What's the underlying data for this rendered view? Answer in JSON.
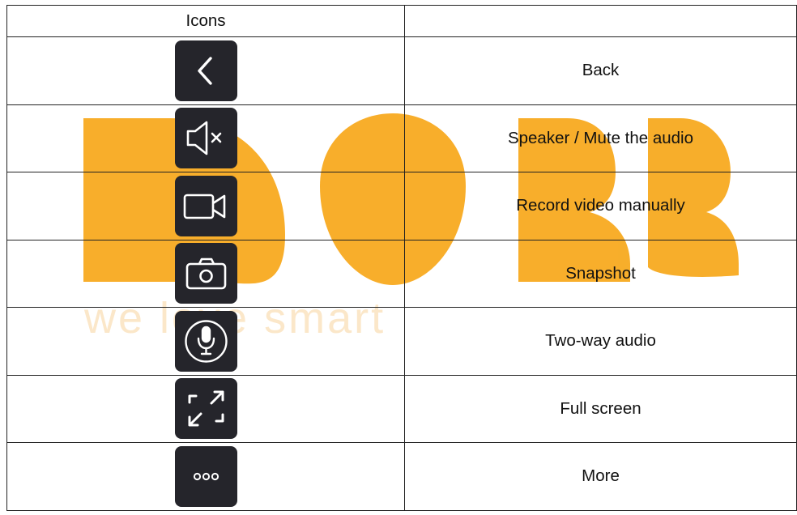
{
  "watermark": {
    "brand_text": "we love smart",
    "color": "#f5a623"
  },
  "table": {
    "headers": [
      "Icons",
      ""
    ],
    "rows": [
      {
        "icon": "back-icon",
        "label": "Back"
      },
      {
        "icon": "speaker-mute-icon",
        "label": "Speaker / Mute the audio"
      },
      {
        "icon": "video-record-icon",
        "label": "Record video manually"
      },
      {
        "icon": "camera-snapshot-icon",
        "label": "Snapshot"
      },
      {
        "icon": "microphone-icon",
        "label": "Two-way audio"
      },
      {
        "icon": "fullscreen-icon",
        "label": "Full screen"
      },
      {
        "icon": "more-icon",
        "label": "More"
      }
    ]
  },
  "colors": {
    "icon_tile": "#25252b",
    "icon_stroke": "#ffffff",
    "border": "#222222"
  }
}
